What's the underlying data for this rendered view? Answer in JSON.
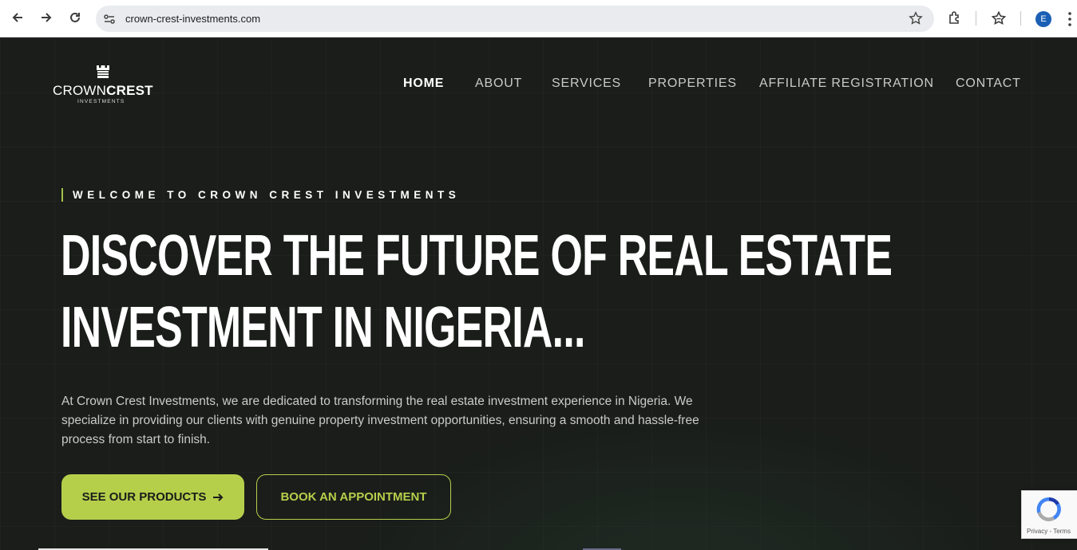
{
  "browser": {
    "url": "crown-crest-investments.com",
    "profile_initial": "E"
  },
  "logo": {
    "name_part1": "CROWN",
    "name_part2": "CREST",
    "sub": "INVESTMENTS"
  },
  "nav": {
    "items": [
      {
        "label": "HOME",
        "active": true
      },
      {
        "label": "ABOUT"
      },
      {
        "label": "SERVICES"
      },
      {
        "label": "PROPERTIES"
      },
      {
        "label": "AFFILIATE REGISTRATION"
      },
      {
        "label": "CONTACT"
      }
    ]
  },
  "hero": {
    "eyebrow": "WELCOME TO CROWN CREST INVESTMENTS",
    "headline_line1": "DISCOVER THE FUTURE OF REAL ESTATE",
    "headline_line2": "INVESTMENT IN NIGERIA...",
    "description": "At Crown Crest Investments, we are dedicated to transforming the real estate investment experience in Nigeria. We specialize in providing our clients with genuine property investment opportunities, ensuring a smooth and hassle-free process from start to finish.",
    "primary_button": "SEE OUR PRODUCTS",
    "secondary_button": "BOOK AN APPOINTMENT"
  },
  "recaptcha": {
    "text": "Privacy - Terms"
  },
  "colors": {
    "accent": "#b5cf4b",
    "background": "#1a1d1a"
  }
}
